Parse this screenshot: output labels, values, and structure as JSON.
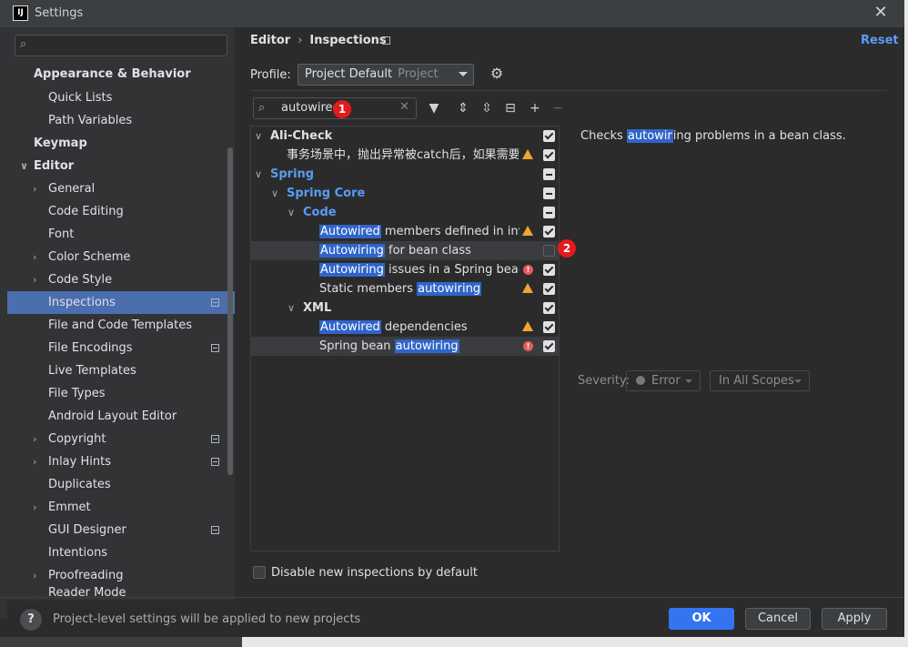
{
  "window": {
    "title": "Settings",
    "app_icon": "IJ"
  },
  "sidebar": {
    "search_placeholder": "",
    "items": [
      {
        "label": "Appearance & Behavior"
      },
      {
        "label": "Quick Lists"
      },
      {
        "label": "Path Variables"
      },
      {
        "label": "Keymap"
      },
      {
        "label": "Editor"
      },
      {
        "label": "General"
      },
      {
        "label": "Code Editing"
      },
      {
        "label": "Font"
      },
      {
        "label": "Color Scheme"
      },
      {
        "label": "Code Style"
      },
      {
        "label": "Inspections"
      },
      {
        "label": "File and Code Templates"
      },
      {
        "label": "File Encodings"
      },
      {
        "label": "Live Templates"
      },
      {
        "label": "File Types"
      },
      {
        "label": "Android Layout Editor"
      },
      {
        "label": "Copyright"
      },
      {
        "label": "Inlay Hints"
      },
      {
        "label": "Duplicates"
      },
      {
        "label": "Emmet"
      },
      {
        "label": "GUI Designer"
      },
      {
        "label": "Intentions"
      },
      {
        "label": "Proofreading"
      },
      {
        "label": "Reader Mode"
      }
    ]
  },
  "header": {
    "breadcrumb": [
      "Editor",
      "Inspections"
    ],
    "breadcrumb_sep": "›",
    "reset": "Reset"
  },
  "profile": {
    "label": "Profile:",
    "value": "Project Default",
    "sub": "Project"
  },
  "filter": {
    "value": "autowired"
  },
  "badges": {
    "one": "1",
    "two": "2"
  },
  "tree": {
    "ali_check": "Ali-Check",
    "ali_item": "事务场景中，抛出异常被catch后，如果需要回滚",
    "spring": "Spring",
    "spring_core": "Spring Core",
    "code": "Code",
    "r1_hl": "Autowired",
    "r1_rest": " members defined in invalid",
    "r2_hl": "Autowiring",
    "r2_rest": " for bean class",
    "r3_hl": "Autowiring",
    "r3_rest": " issues in a Spring bean cla",
    "r4_pre": "Static members ",
    "r4_hl": "autowiring",
    "xml": "XML",
    "r5_hl": "Autowired",
    "r5_rest": " dependencies",
    "r6_pre": "Spring bean ",
    "r6_hl": "autowiring"
  },
  "description": {
    "pre": "Checks ",
    "hl": "autowir",
    "rest": "ing problems in a bean class."
  },
  "severity": {
    "label": "Severity:",
    "value": "Error",
    "scope": "In All Scopes"
  },
  "disable_new": "Disable new inspections by default",
  "footer": {
    "note": "Project-level settings will be applied to new projects",
    "help": "?",
    "ok": "OK",
    "cancel": "Cancel",
    "apply": "Apply"
  },
  "colors": {
    "accent": "#3574f0",
    "selection": "#4b6eaf",
    "link": "#589df6",
    "match": "#2f65ca"
  }
}
